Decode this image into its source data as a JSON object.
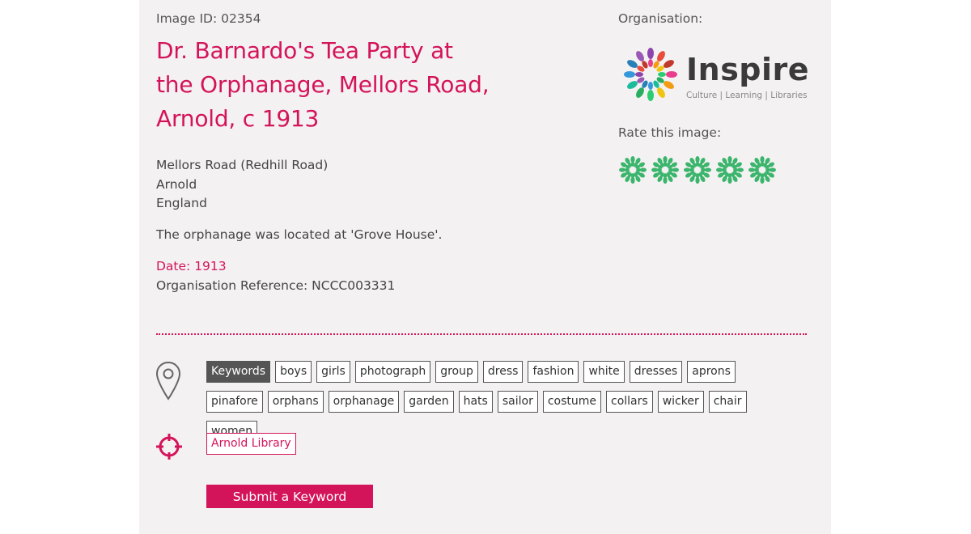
{
  "record": {
    "image_id": "Image ID: 02354",
    "title": "Dr. Barnardo's Tea Party at the Orphanage, Mellors Road, Arnold, c 1913",
    "address": [
      "Mellors Road (Redhill Road)",
      "Arnold",
      "England"
    ],
    "description": "The orphanage was located at 'Grove House'.",
    "date": "Date: 1913",
    "organisation_reference": "Organisation Reference: NCCC003331"
  },
  "organisation": {
    "label": "Organisation:",
    "logo_name": "Inspire",
    "logo_tagline": "Culture | Learning | Libraries",
    "logo_petal_colors": [
      "#e83e8c",
      "#f39c12",
      "#f1c40f",
      "#2ecc71",
      "#27ae60",
      "#1abc9c",
      "#3498db",
      "#2980b9",
      "#9b59b6",
      "#8e44ad",
      "#e74c3c",
      "#c0392b"
    ]
  },
  "rating": {
    "label": "Rate this image:",
    "max": 5,
    "star_icon": "flower-rating-icon",
    "color": "#3bb56c"
  },
  "keywords": {
    "label": "Keywords",
    "items": [
      "boys",
      "girls",
      "photograph",
      "group",
      "dress",
      "fashion",
      "white",
      "dresses",
      "aprons",
      "pinafore",
      "orphans",
      "orphanage",
      "garden",
      "hats",
      "sailor",
      "costume",
      "collars",
      "wicker",
      "chair",
      "women"
    ]
  },
  "location": {
    "library": "Arnold Library"
  },
  "actions": {
    "submit_keyword": "Submit a Keyword"
  },
  "colors": {
    "accent": "#d4145a",
    "panel_background": "#f4f1f2",
    "keyword_label_background": "#555555"
  }
}
